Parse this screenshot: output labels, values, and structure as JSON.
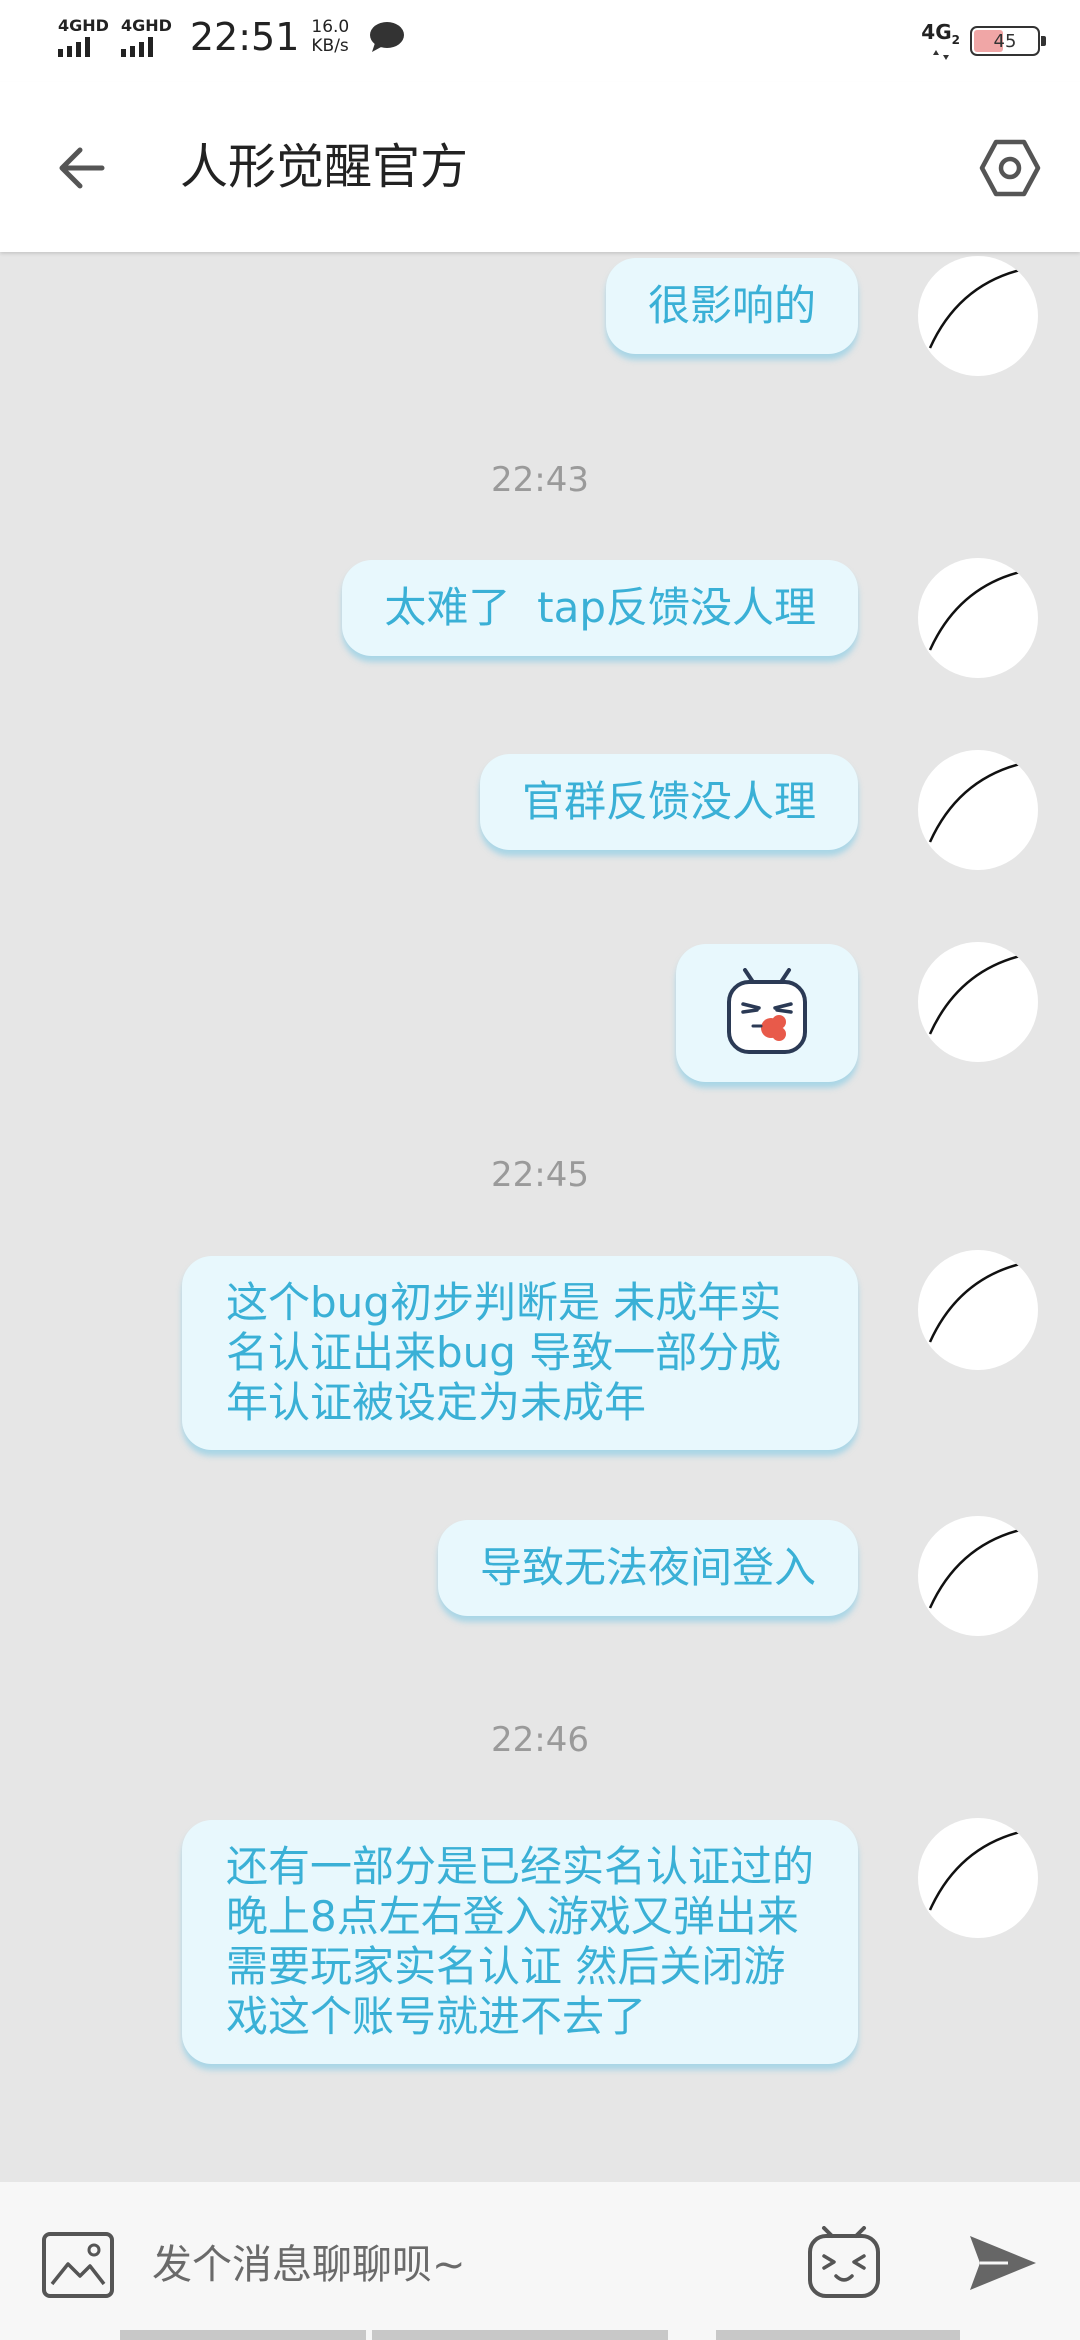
{
  "status_bar": {
    "signal1": "4GHD",
    "signal2": "4GHD",
    "time": "22:51",
    "speed_value": "16.0",
    "speed_unit": "KB/s",
    "network": "4G",
    "network_sub": "2",
    "battery": "45"
  },
  "header": {
    "title": "人形觉醒官方",
    "back_icon": "back-arrow-icon",
    "settings_icon": "settings-hexagon-icon"
  },
  "messages": [
    {
      "type": "text",
      "text": "很影响的"
    },
    {
      "type": "time",
      "text": "22:43"
    },
    {
      "type": "text",
      "text": "太难了  tap反馈没人理"
    },
    {
      "type": "text",
      "text": "官群反馈没人理"
    },
    {
      "type": "sticker",
      "icon": "tv-mascot-sticker-icon"
    },
    {
      "type": "time",
      "text": "22:45"
    },
    {
      "type": "text",
      "text": "这个bug初步判断是 未成年实名认证出来bug 导致一部分成年认证被设定为未成年"
    },
    {
      "type": "text",
      "text": "导致无法夜间登入"
    },
    {
      "type": "time",
      "text": "22:46"
    },
    {
      "type": "text",
      "text": "还有一部分是已经实名认证过的  晚上8点左右登入游戏又弹出来需要玩家实名认证  然后关闭游戏这个账号就进不去了"
    }
  ],
  "input_bar": {
    "placeholder": "发个消息聊聊呗~",
    "image_icon": "image-icon",
    "emoji_icon": "tv-emoji-icon",
    "send_icon": "send-icon"
  },
  "colors": {
    "bubble_bg": "#e8f8fd",
    "bubble_text": "#3ab0d6",
    "chat_bg": "#e6e6e6"
  }
}
